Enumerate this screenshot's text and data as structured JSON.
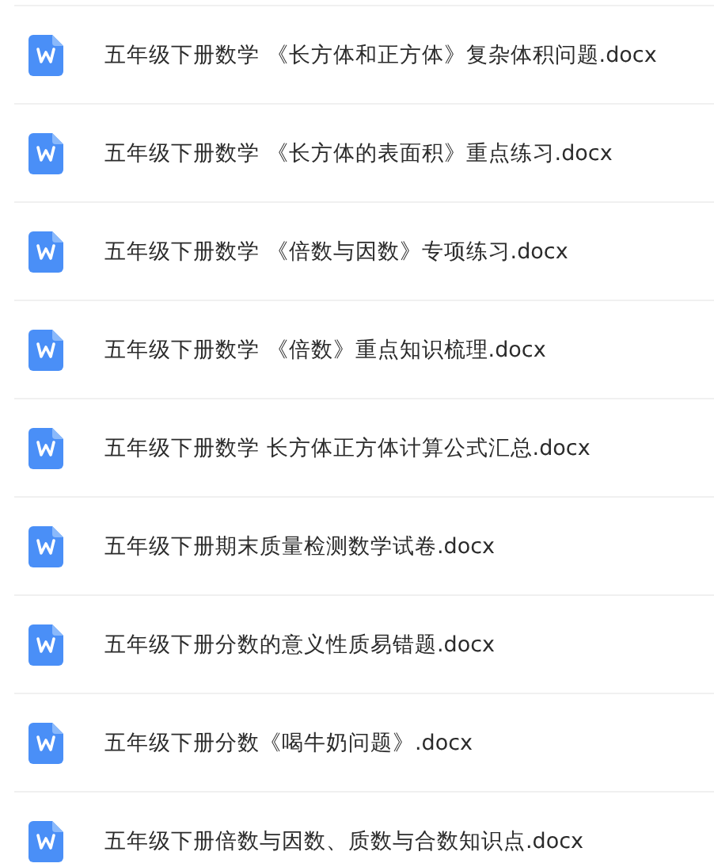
{
  "files": [
    {
      "name": "五年级下册数学 《长方体和正方体》复杂体积问题.docx"
    },
    {
      "name": "五年级下册数学 《长方体的表面积》重点练习.docx"
    },
    {
      "name": "五年级下册数学 《倍数与因数》专项练习.docx"
    },
    {
      "name": "五年级下册数学 《倍数》重点知识梳理.docx"
    },
    {
      "name": "五年级下册数学 长方体正方体计算公式汇总.docx"
    },
    {
      "name": "五年级下册期末质量检测数学试卷.docx"
    },
    {
      "name": "五年级下册分数的意义性质易错题.docx"
    },
    {
      "name": "五年级下册分数《喝牛奶问题》.docx"
    },
    {
      "name": "五年级下册倍数与因数、质数与合数知识点.docx"
    }
  ]
}
